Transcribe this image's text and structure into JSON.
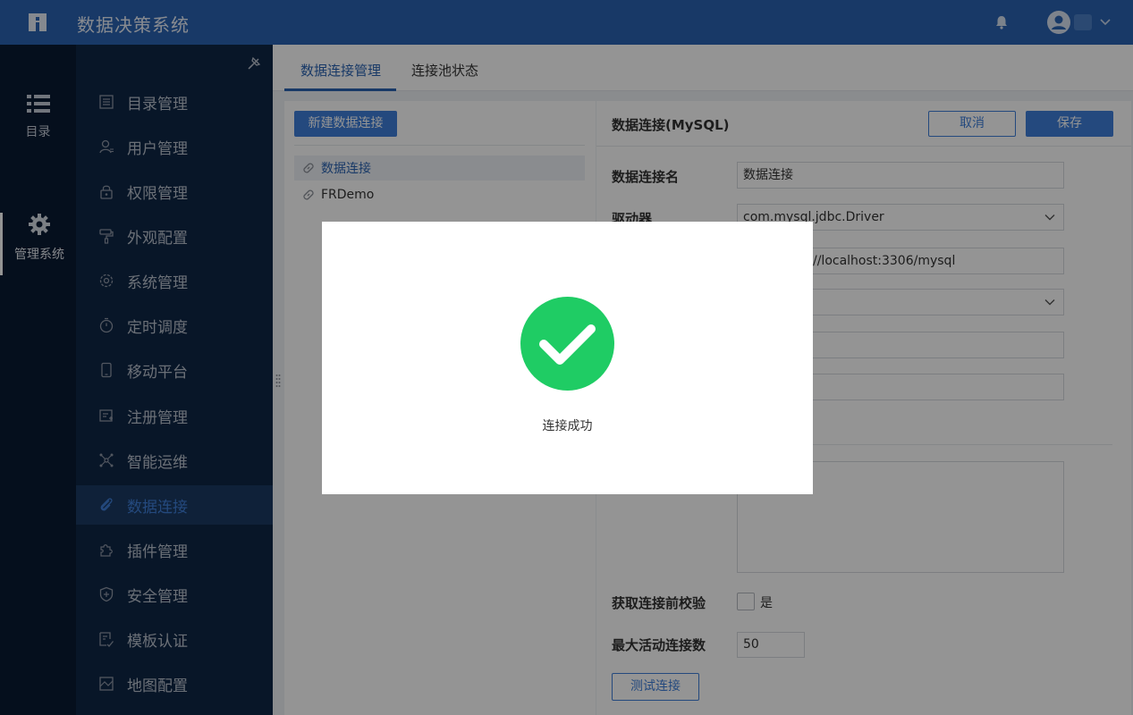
{
  "header": {
    "title": "数据决策系统",
    "logo_icon": "fr-logo-icon",
    "bell_icon": "bell-icon",
    "avatar_icon": "user-avatar-icon",
    "accent": "#2a63b1"
  },
  "rail": {
    "items": [
      {
        "label": "目录",
        "icon": "list-icon"
      },
      {
        "label": "管理系统",
        "icon": "gear-icon"
      }
    ]
  },
  "submenu": {
    "items": [
      {
        "label": "目录管理",
        "icon": "catalog-icon"
      },
      {
        "label": "用户管理",
        "icon": "user-icon"
      },
      {
        "label": "权限管理",
        "icon": "lock-icon"
      },
      {
        "label": "外观配置",
        "icon": "paint-roller-icon"
      },
      {
        "label": "系统管理",
        "icon": "settings-icon"
      },
      {
        "label": "定时调度",
        "icon": "timer-icon"
      },
      {
        "label": "移动平台",
        "icon": "mobile-icon"
      },
      {
        "label": "注册管理",
        "icon": "register-icon"
      },
      {
        "label": "智能运维",
        "icon": "nodes-icon"
      },
      {
        "label": "数据连接",
        "icon": "paperclip-icon"
      },
      {
        "label": "插件管理",
        "icon": "puzzle-icon"
      },
      {
        "label": "安全管理",
        "icon": "shield-icon"
      },
      {
        "label": "模板认证",
        "icon": "certificate-icon"
      },
      {
        "label": "地图配置",
        "icon": "map-icon"
      }
    ],
    "active_index": 9
  },
  "tabs": [
    {
      "label": "数据连接管理"
    },
    {
      "label": "连接池状态"
    }
  ],
  "left_panel": {
    "new_button": "新建数据连接",
    "connections": [
      {
        "label": "数据连接"
      },
      {
        "label": "FRDemo"
      }
    ]
  },
  "right_panel": {
    "title": "数据连接(MySQL)",
    "cancel": "取消",
    "save": "保存",
    "fields": {
      "name_label": "数据连接名",
      "name_value": "数据连接",
      "driver_label": "驱动器",
      "driver_value": "com.mysql.jdbc.Driver",
      "url_value": "//localhost:3306/mysql",
      "validate_label": "获取连接前校验",
      "validate_option": "是",
      "max_active_label": "最大活动连接数",
      "max_active_value": "50"
    },
    "test_button": "测试连接"
  },
  "dialog": {
    "message": "连接成功",
    "icon": "check-circle-icon",
    "success_color": "#1fcc64"
  }
}
